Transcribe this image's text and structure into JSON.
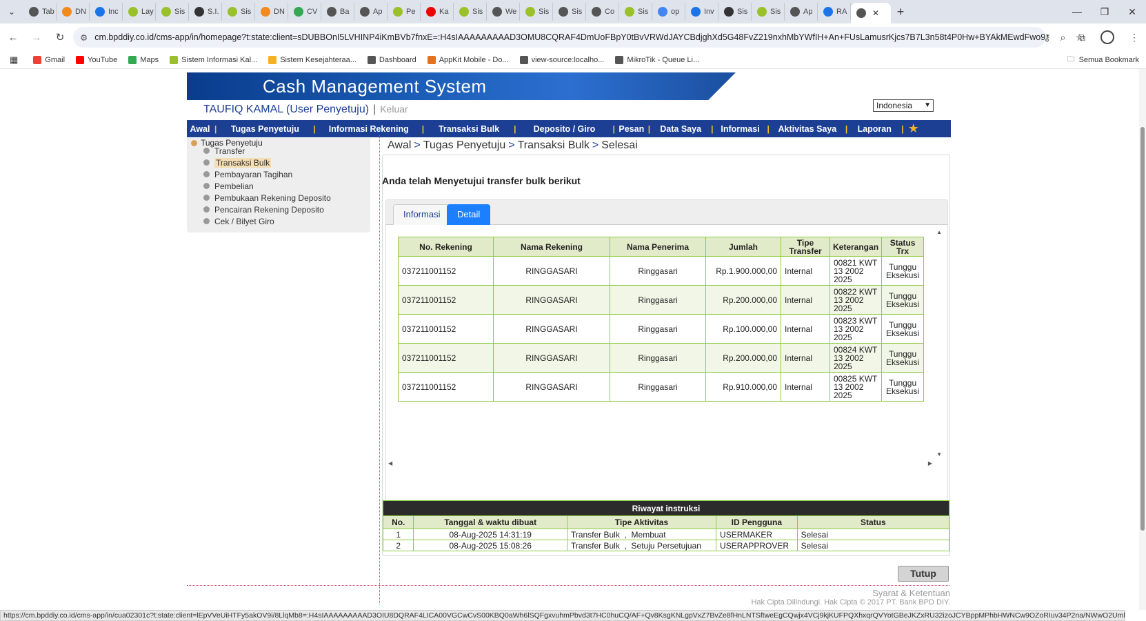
{
  "browser": {
    "tabs": [
      {
        "label": "Tab",
        "color": "#555"
      },
      {
        "label": "DN",
        "color": "#f28a1c"
      },
      {
        "label": "Inc",
        "color": "#1b74e8"
      },
      {
        "label": "Lay",
        "color": "#9ac02a"
      },
      {
        "label": "Sis",
        "color": "#9ac02a"
      },
      {
        "label": "S.I.",
        "color": "#333"
      },
      {
        "label": "Sis",
        "color": "#9ac02a"
      },
      {
        "label": "DN",
        "color": "#f28a1c"
      },
      {
        "label": "CV",
        "color": "#34a853"
      },
      {
        "label": "Ba",
        "color": "#555"
      },
      {
        "label": "Ap",
        "color": "#555"
      },
      {
        "label": "Pe",
        "color": "#9ac02a"
      },
      {
        "label": "Ka",
        "color": "#e00"
      },
      {
        "label": "Sis",
        "color": "#9ac02a"
      },
      {
        "label": "We",
        "color": "#555"
      },
      {
        "label": "Sis",
        "color": "#9ac02a"
      },
      {
        "label": "Sis",
        "color": "#555"
      },
      {
        "label": "Co",
        "color": "#555"
      },
      {
        "label": "Sis",
        "color": "#9ac02a"
      },
      {
        "label": "op",
        "color": "#4285f4"
      },
      {
        "label": "Inv",
        "color": "#1b74e8"
      },
      {
        "label": "Sis",
        "color": "#333"
      },
      {
        "label": "Sis",
        "color": "#9ac02a"
      },
      {
        "label": "Ap",
        "color": "#555"
      },
      {
        "label": "RA",
        "color": "#1b74e8"
      }
    ],
    "active_tab": {
      "label": "",
      "color": "#555"
    },
    "url": "cm.bpddiy.co.id/cms-app/in/homepage?t:state:client=sDUBBOnI5LVHINP4iKmBVb7fnxE=:H4sIAAAAAAAAAD3OMU8CQRAF4DmUoFBpY0tBvVRWdJAYCBdjghXd5G48FvZ219nxhMbYWfIH+An+FUsLamusrKjcs7B7L3n58t4P0Hw+BYAkMEwdFwo9Z...",
    "bookmarks": [
      {
        "label": "Gmail",
        "icon": "gmail-icon",
        "color": "#ea4335"
      },
      {
        "label": "YouTube",
        "icon": "youtube-icon",
        "color": "#ff0000"
      },
      {
        "label": "Maps",
        "icon": "maps-icon",
        "color": "#34a853"
      },
      {
        "label": "Sistem Informasi Kal...",
        "icon": "site-icon",
        "color": "#9ac02a"
      },
      {
        "label": "Sistem Kesejahteraa...",
        "icon": "site-icon",
        "color": "#f3b221"
      },
      {
        "label": "Dashboard",
        "icon": "globe-icon",
        "color": "#555"
      },
      {
        "label": "AppKit Mobile - Do...",
        "icon": "appkit-icon",
        "color": "#e8711c"
      },
      {
        "label": "view-source:localho...",
        "icon": "globe-icon",
        "color": "#555"
      },
      {
        "label": "MikroTik - Queue Li...",
        "icon": "globe-icon",
        "color": "#555"
      }
    ],
    "all_bookmarks": "Semua Bookmark",
    "status_url": "https://cm.bpddiy.co.id/cms-app/in/cua02301c?t:state:client=lEpVVeUiHTFy5akOV9i/8LlqMb8=:H4sIAAAAAAAAAD3OIU8DQRAF4LICA00VGCwCvS00KBQ0aWh6lSQFgxvuhmPbvd3t7HC0huCQ/AF+Qv8KsgKNLgpVxZ7BvZe8fHnLNTSftweEgCQwjx4VCj9kjKUFPQXhxqrQVYotGBeJKZxRU32izoJCYBppMPhbHWNCw9OZoRIuv34P2na/NWwO2UmhnrvTOxuk..."
  },
  "header": {
    "app_title": "Cash Management System",
    "user": "TAUFIQ KAMAL (User Penyetuju)",
    "logout": "Keluar",
    "language": "Indonesia"
  },
  "nav": [
    "Awal",
    "Tugas Penyetuju",
    "Informasi Rekening",
    "Transaksi Bulk",
    "Deposito / Giro",
    "Pesan",
    "Data Saya",
    "Informasi",
    "Aktivitas Saya",
    "Laporan"
  ],
  "sidebar": {
    "root": "Tugas Penyetuju",
    "items": [
      "Transfer",
      "Transaksi Bulk",
      "Pembayaran Tagihan",
      "Pembelian",
      "Pembukaan Rekening Deposito",
      "Pencairan Rekening Deposito",
      "Cek / Bilyet Giro"
    ],
    "selected": "Transaksi Bulk"
  },
  "breadcrumb": [
    "Awal",
    "Tugas Penyetuju",
    "Transaksi Bulk",
    "Selesai"
  ],
  "main": {
    "heading": "Anda telah Menyetujui transfer bulk berikut",
    "tabs": [
      "Informasi",
      "Detail"
    ],
    "active_tab": "Detail"
  },
  "detail_table": {
    "headers": [
      "No. Rekening",
      "Nama Rekening",
      "Nama Penerima",
      "Jumlah",
      "Tipe Transfer",
      "Keterangan",
      "Status Trx"
    ],
    "rows": [
      [
        "037211001152",
        "RINGGASARI",
        "Ringgasari",
        "Rp.1.900.000,00",
        "Internal",
        "00821 KWT 13 2002 2025",
        "Tunggu Eksekusi"
      ],
      [
        "037211001152",
        "RINGGASARI",
        "Ringgasari",
        "Rp.200.000,00",
        "Internal",
        "00822 KWT 13 2002 2025",
        "Tunggu Eksekusi"
      ],
      [
        "037211001152",
        "RINGGASARI",
        "Ringgasari",
        "Rp.100.000,00",
        "Internal",
        "00823 KWT 13 2002 2025",
        "Tunggu Eksekusi"
      ],
      [
        "037211001152",
        "RINGGASARI",
        "Ringgasari",
        "Rp.200.000,00",
        "Internal",
        "00824 KWT 13 2002 2025",
        "Tunggu Eksekusi"
      ],
      [
        "037211001152",
        "RINGGASARI",
        "Ringgasari",
        "Rp.910.000,00",
        "Internal",
        "00825 KWT 13 2002 2025",
        "Tunggu Eksekusi"
      ]
    ]
  },
  "history": {
    "title": "Riwayat instruksi",
    "headers": [
      "No.",
      "Tanggal & waktu dibuat",
      "Tipe Aktivitas",
      "ID Pengguna",
      "Status"
    ],
    "rows": [
      [
        "1",
        "08-Aug-2025 14:31:19",
        "Transfer Bulk",
        "Membuat",
        "USERMAKER",
        "Selesai"
      ],
      [
        "2",
        "08-Aug-2025 15:08:26",
        "Transfer Bulk",
        "Setuju Persetujuan",
        "USERAPPROVER",
        "Selesai"
      ]
    ]
  },
  "close_button": "Tutup",
  "footer": {
    "terms": "Syarat & Ketentuan",
    "copyright": "Hak Cipta Dilindungi. Hak Cipta © 2017 PT. Bank BPD DIY."
  },
  "colors": {
    "nav_bg": "#1c3f94",
    "nav_sep": "#f3c623",
    "table_border": "#8ccb3c",
    "tab_active": "#1c7fff"
  }
}
